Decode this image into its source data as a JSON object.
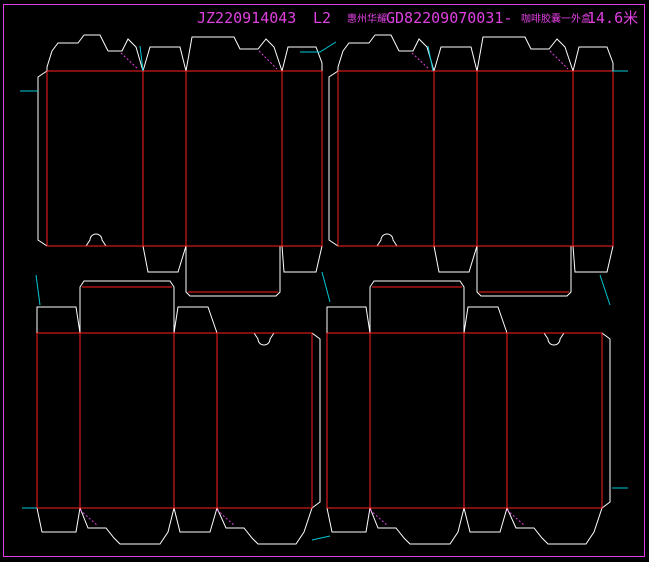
{
  "title_bar": {
    "job_code": "JZ220914043",
    "layout_code": "L2",
    "customer": "惠州华耀",
    "order_code": "GD82209070031-",
    "product": "咖啡胶囊一外盒",
    "size": "14.6米"
  },
  "colors": {
    "background": "#000000",
    "frame": "#e040e0",
    "cut_line": "#ffffff",
    "crease_line": "#ff2020",
    "bridge_line": "#00c8d8",
    "perforation": "#e040e0"
  }
}
